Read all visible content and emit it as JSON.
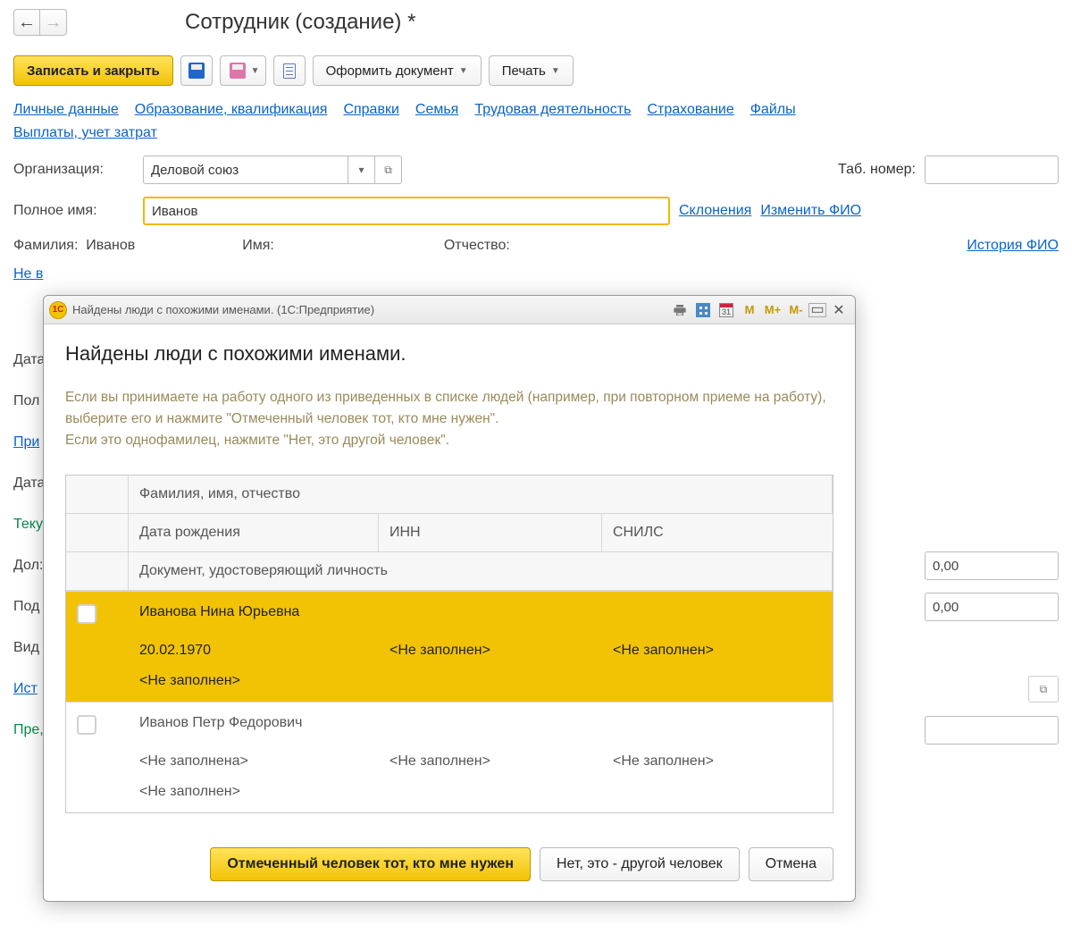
{
  "window_title": "Сотрудник (создание) *",
  "buttons": {
    "save_close": "Записать и закрыть",
    "format_doc": "Оформить документ",
    "print": "Печать"
  },
  "links": {
    "personal": "Личные данные",
    "education": "Образование, квалификация",
    "refs": "Справки",
    "family": "Семья",
    "work": "Трудовая деятельность",
    "insurance": "Страхование",
    "files": "Файлы",
    "payouts": "Выплаты, учет затрат",
    "declensions": "Склонения",
    "change_fio": "Изменить ФИО",
    "fio_history": "История ФИО"
  },
  "labels": {
    "org": "Организация:",
    "tab_no": "Таб. номер:",
    "fullname": "Полное имя:",
    "surname": "Фамилия:",
    "name": "Имя:",
    "patronymic": "Отчество:",
    "not_entered": "Не в",
    "date_row": "Дата",
    "pol": "Пол",
    "pri": "При",
    "teku": "Теку",
    "dolya": "Дол:",
    "pod": "Под",
    "vid": "Вид",
    "ist": "Ист",
    "pred": "Пре,"
  },
  "values": {
    "org": "Деловой союз",
    "fullname": "Иванов",
    "surname": "Иванов",
    "zero": "0,00"
  },
  "dialog": {
    "titlebar": "Найдены люди с похожими именами.  (1С:Предприятие)",
    "heading": "Найдены люди с похожими именами.",
    "description1": "Если вы принимаете на работу одного из приведенных в списке людей (например, при повторном приеме на работу), выберите его и нажмите \"Отмеченный человек тот, кто мне нужен\".",
    "description2": "Если это однофамилец, нажмите \"Нет, это другой человек\".",
    "headers": {
      "fio": "Фамилия, имя, отчество",
      "dob": "Дата рождения",
      "inn": "ИНН",
      "snils": "СНИЛС",
      "doc": "Документ, удостоверяющий личность"
    },
    "rows": [
      {
        "name": "Иванова Нина Юрьевна",
        "dob": "20.02.1970",
        "inn": "<Не заполнен>",
        "snils": "<Не заполнен>",
        "doc": "<Не заполнен>"
      },
      {
        "name": "Иванов Петр Федорович",
        "dob": "<Не заполнена>",
        "inn": "<Не заполнен>",
        "snils": "<Не заполнен>",
        "doc": "<Не заполнен>"
      }
    ],
    "actions": {
      "confirm": "Отмеченный человек тот, кто мне нужен",
      "other": "Нет, это - другой человек",
      "cancel": "Отмена"
    },
    "tools": {
      "m": "M",
      "mplus": "M+",
      "mminus": "M-",
      "cal": "31"
    }
  }
}
